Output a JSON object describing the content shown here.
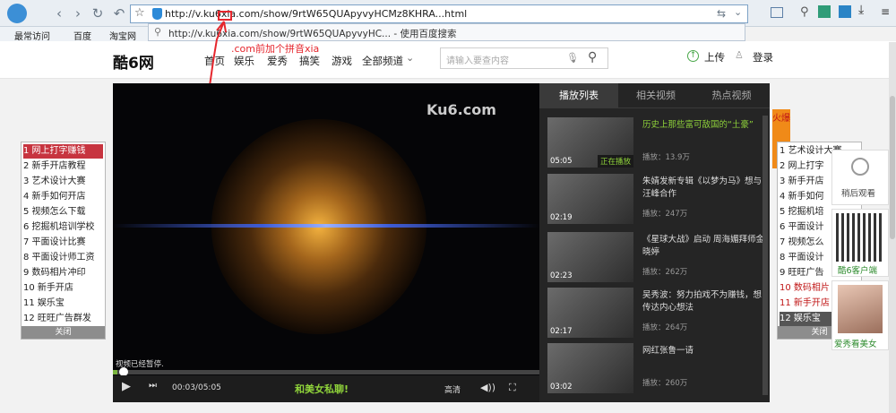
{
  "browser": {
    "url": "http://v.ku6xia.com/show/9rtW65QUApyvyHCMz8KHRA...html",
    "suggestion": "http://v.ku6xia.com/show/9rtW65QUApyvyHC... - 使用百度搜索",
    "bookmarks": [
      "最常访问",
      "百度",
      "淘宝网"
    ],
    "annotation": ".com前加个拼音xia"
  },
  "site": {
    "logo": "酷6网",
    "nav": [
      "首页",
      "娱乐",
      "爱秀",
      "搞笑",
      "游戏",
      "全部频道"
    ],
    "search_placeholder": "请输入要查内容",
    "upload": "上传",
    "login": "登录"
  },
  "player": {
    "watermark": "Ku6.com",
    "status": "视频已经暂停.",
    "time": "00:03/05:05",
    "promo": "和美女私聊!",
    "quality": "高清",
    "progress": 0.01
  },
  "playlist": {
    "tabs": [
      "播放列表",
      "相关视频",
      "热点视频"
    ],
    "items": [
      {
        "title": "历史上那些富可敌国的“土豪”",
        "plays": "播放：13.9万",
        "duration": "05:05",
        "tag": "正在播放"
      },
      {
        "title": "朱婧发新专辑《以梦为马》想与汪峰合作",
        "plays": "播放：247万",
        "duration": "02:19",
        "tag": ""
      },
      {
        "title": "《星球大战》启动 周海媚拜师金晓婷",
        "plays": "播放：262万",
        "duration": "02:23",
        "tag": ""
      },
      {
        "title": "吴秀波：努力拍戏不为赚钱，想传达内心想法",
        "plays": "播放：264万",
        "duration": "02:17",
        "tag": ""
      },
      {
        "title": "网红张鲁一请",
        "plays": "播放：260万",
        "duration": "03:02",
        "tag": ""
      }
    ]
  },
  "leftlist": {
    "items": [
      "网上打字赚钱",
      "新手开店教程",
      "艺术设计大赛",
      "新手如何开店",
      "视频怎么下载",
      "挖掘机培训学校",
      "平面设计比赛",
      "平面设计师工资",
      "数码相片冲印",
      "新手开店",
      "娱乐宝",
      "旺旺广告群发"
    ],
    "close": "关闭"
  },
  "rightlist": {
    "header": "火爆",
    "items": [
      "艺术设计大赛",
      "网上打字",
      "新手开店",
      "新手如何",
      "挖掘机培",
      "平面设计",
      "视频怎么",
      "平面设计",
      "旺旺广告",
      "数码相片",
      "新手开店",
      "娱乐宝"
    ],
    "close": "关闭"
  },
  "widgets": {
    "watch_later": "稍后观看",
    "client": "酷6客户端",
    "beauty": "爱秀看美女"
  }
}
